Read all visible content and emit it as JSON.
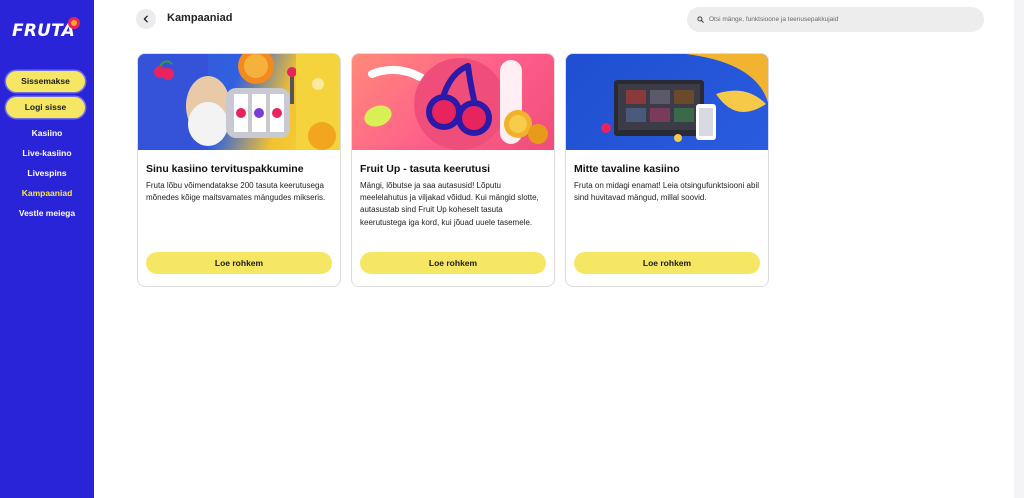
{
  "brand": {
    "logo_text": "FRUTA"
  },
  "sidebar": {
    "signup_label": "Sissemakse",
    "login_label": "Logi sisse",
    "items": [
      {
        "label": "Kasiino"
      },
      {
        "label": "Live-kasiino"
      },
      {
        "label": "Livespins"
      },
      {
        "label": "Kampaaniad",
        "active": true
      },
      {
        "label": "Vestle meiega"
      }
    ]
  },
  "header": {
    "title": "Kampaaniad",
    "search_placeholder": "Otsi mänge, funktsioone ja teenusepakkujaid"
  },
  "cards": [
    {
      "title": "Sinu kasiino tervituspakkumine",
      "description": "Fruta lõbu võimendatakse 200 tasuta keerutusega mõnedes kõige maitsvamates mängudes mikseris.",
      "button": "Loe rohkem"
    },
    {
      "title": "Fruit Up - tasuta keerutusi",
      "description": "Mängi, lõbutse ja saa autasusid! Lõputu meelelahutus ja viljakad võidud. Kui mängid slotte, autasustab sind Fruit Up koheselt tasuta keerutustega iga kord, kui jõuad uuele tasemele.",
      "button": "Loe rohkem"
    },
    {
      "title": "Mitte tavaline kasiino",
      "description": "Fruta on midagi enamat! Leia otsingufunktsiooni abil sind huvitavad mängud, millal soovid.",
      "button": "Loe rohkem"
    }
  ],
  "colors": {
    "sidebar_bg": "#2a24d8",
    "accent_yellow": "#f5e663",
    "active_nav": "#f5e663"
  }
}
